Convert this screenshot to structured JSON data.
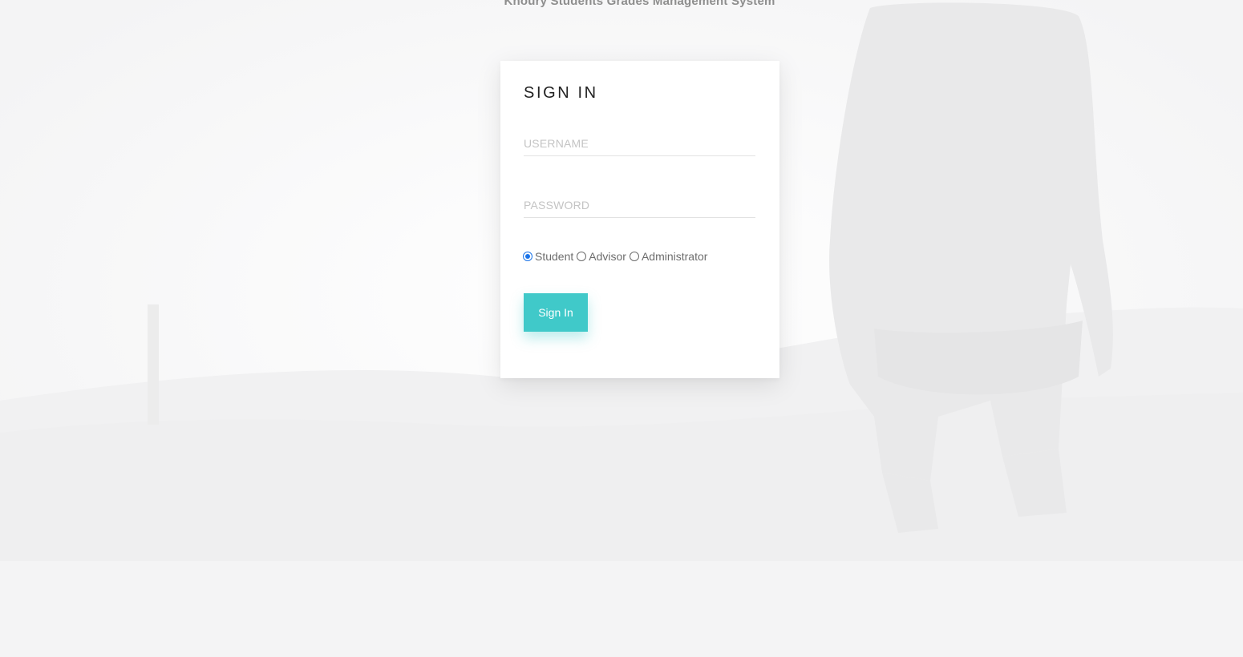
{
  "header": {
    "app_title": "Khoury Students Grades Management System"
  },
  "signin": {
    "title": "SIGN IN",
    "username_placeholder": "USERNAME",
    "password_placeholder": "PASSWORD",
    "roles": [
      {
        "label": "Student",
        "selected": true
      },
      {
        "label": "Advisor",
        "selected": false
      },
      {
        "label": "Administrator",
        "selected": false
      }
    ],
    "button_label": "Sign In"
  },
  "colors": {
    "accent": "#40c9c9",
    "radio_selected": "#1a73e8",
    "title_text": "#8e8e8e"
  }
}
